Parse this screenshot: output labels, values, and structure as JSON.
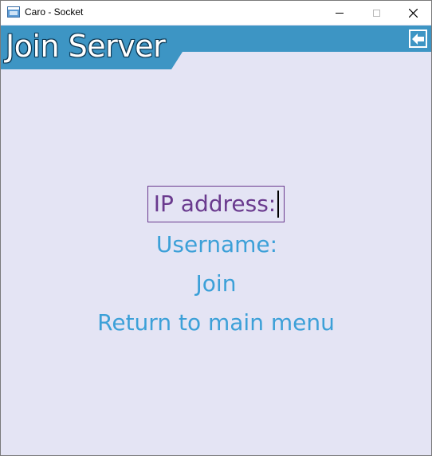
{
  "window": {
    "title": "Caro - Socket",
    "controls": {
      "minimize": "minimize",
      "maximize": "maximize",
      "close": "close"
    }
  },
  "header": {
    "title": "Join Server",
    "back_icon": "arrow-left-icon",
    "accent_color": "#3d95c4"
  },
  "form": {
    "ip_label": "IP address:",
    "ip_value": "",
    "username_label": "Username:",
    "username_value": "",
    "active_field": "ip_address"
  },
  "menu": {
    "join_label": "Join",
    "return_label": "Return to main menu"
  },
  "colors": {
    "background": "#e4e4f4",
    "menu_text": "#3ca0d8",
    "focused_text": "#6a3a8e"
  }
}
